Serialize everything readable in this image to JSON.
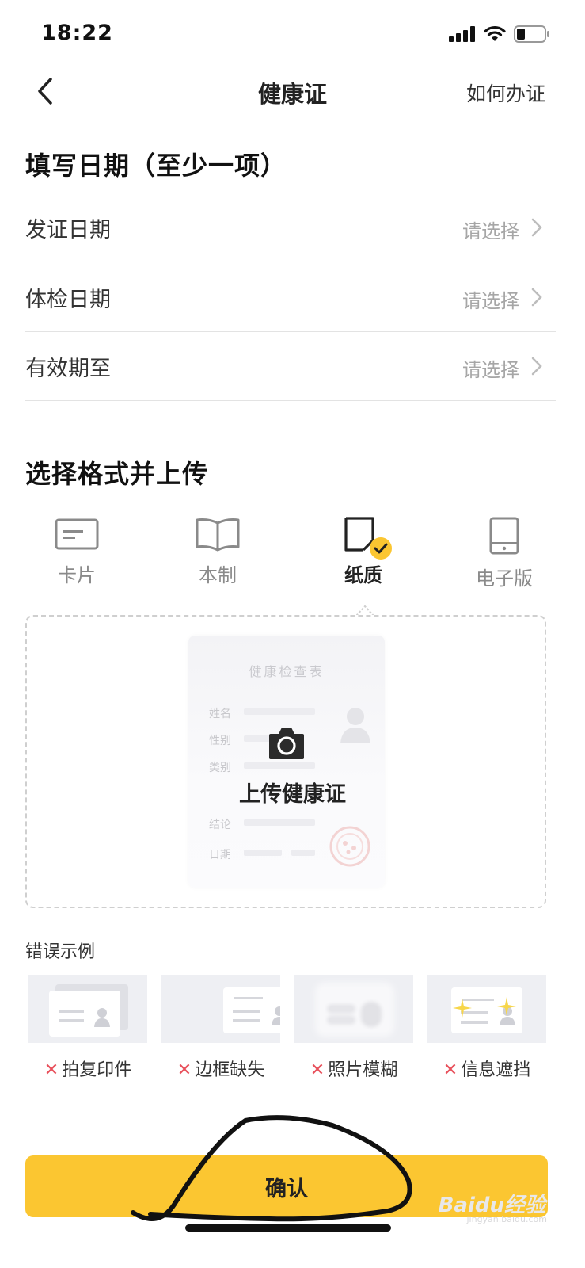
{
  "status": {
    "time": "18:22"
  },
  "nav": {
    "title": "健康证",
    "right_link": "如何办证"
  },
  "dates_section": {
    "title": "填写日期（至少一项）",
    "rows": [
      {
        "label": "发证日期",
        "value": "请选择"
      },
      {
        "label": "体检日期",
        "value": "请选择"
      },
      {
        "label": "有效期至",
        "value": "请选择"
      }
    ]
  },
  "format_section": {
    "title": "选择格式并上传",
    "tabs": [
      {
        "label": "卡片",
        "icon": "card-icon"
      },
      {
        "label": "本制",
        "icon": "book-icon"
      },
      {
        "label": "纸质",
        "icon": "paper-icon",
        "selected": true
      },
      {
        "label": "电子版",
        "icon": "tablet-icon"
      }
    ]
  },
  "upload": {
    "doc_title": "健康检查表",
    "fields": [
      "姓名",
      "性别",
      "类别",
      "结论",
      "日期"
    ],
    "label": "上传健康证",
    "icon": "camera-icon"
  },
  "examples": {
    "title": "错误示例",
    "items": [
      {
        "label": "拍复印件"
      },
      {
        "label": "边框缺失"
      },
      {
        "label": "照片模糊"
      },
      {
        "label": "信息遮挡"
      }
    ],
    "mark": "✕"
  },
  "confirm": {
    "label": "确认"
  },
  "watermark": {
    "brand": "Baidu经验",
    "url": "jingyan.baidu.com"
  },
  "colors": {
    "accent": "#fbc631",
    "error": "#e8505b",
    "muted": "#a6a6a6"
  }
}
